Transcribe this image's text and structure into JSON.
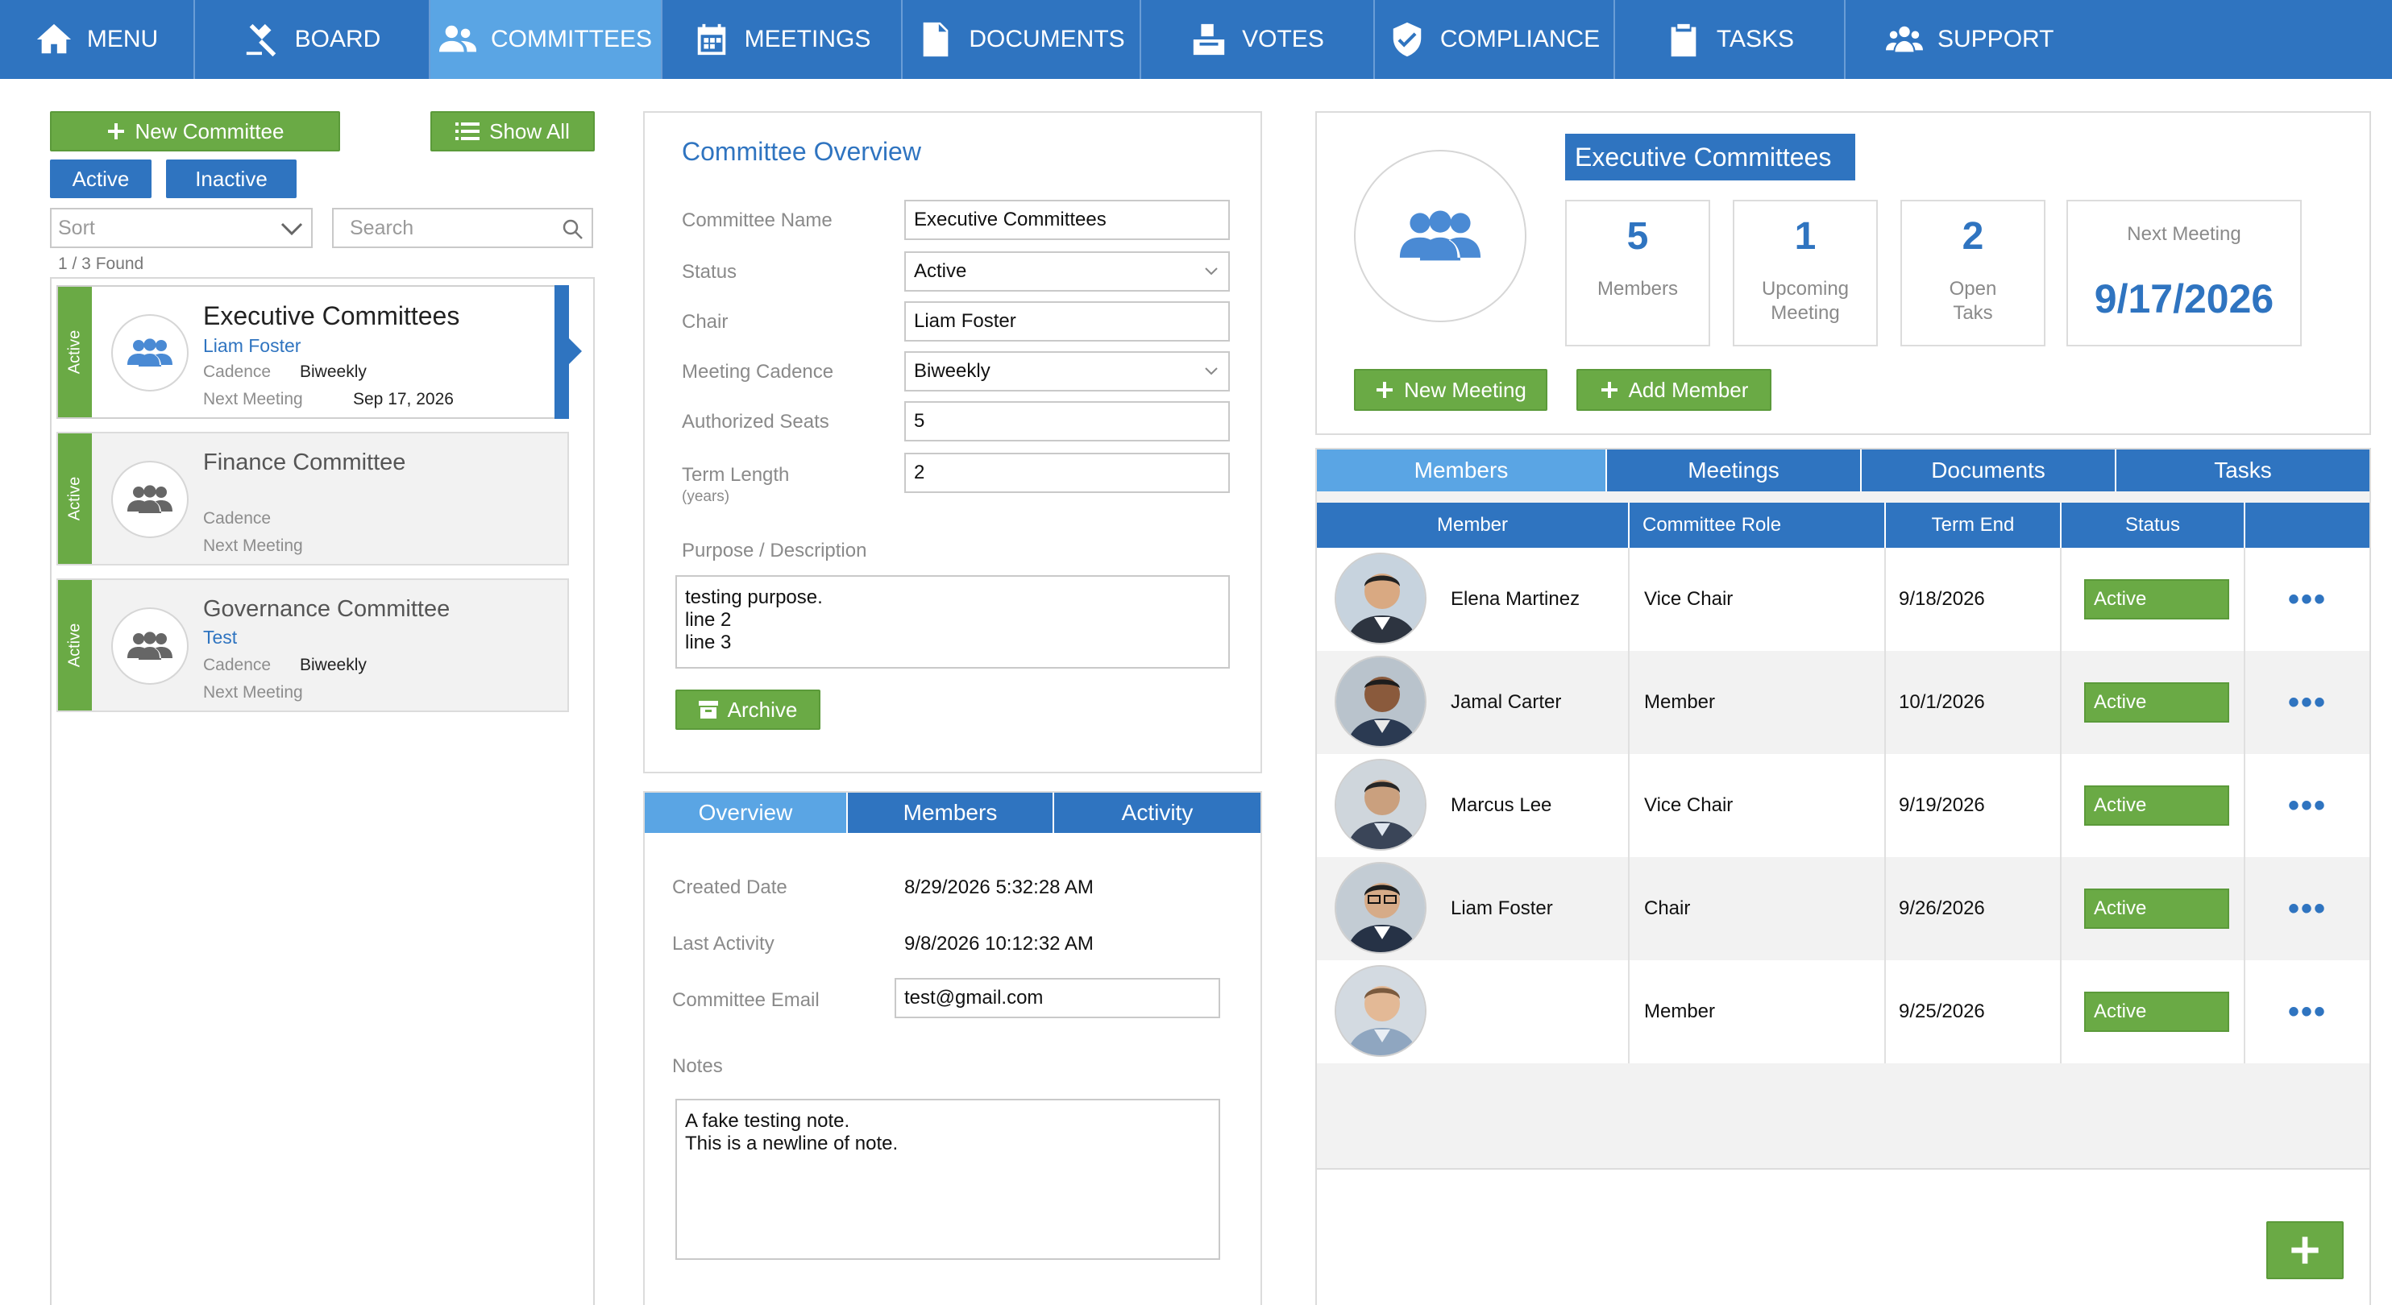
{
  "nav": {
    "items": [
      {
        "label": "MENU",
        "icon": "home-icon"
      },
      {
        "label": "BOARD",
        "icon": "gavel-icon"
      },
      {
        "label": "COMMITTEES",
        "icon": "people-icon"
      },
      {
        "label": "MEETINGS",
        "icon": "calendar-icon"
      },
      {
        "label": "DOCUMENTS",
        "icon": "document-icon"
      },
      {
        "label": "VOTES",
        "icon": "ballot-box-icon"
      },
      {
        "label": "COMPLIANCE",
        "icon": "shield-check-icon"
      },
      {
        "label": "TASKS",
        "icon": "clipboard-check-icon"
      },
      {
        "label": "SUPPORT",
        "icon": "support-group-icon"
      }
    ],
    "active": "COMMITTEES"
  },
  "left": {
    "new_committee": "New Committee",
    "show_all": "Show All",
    "filter_active": "Active",
    "filter_inactive": "Inactive",
    "sort_placeholder": "Sort",
    "search_placeholder": "Search",
    "found": "1 / 3 Found",
    "cadence_label": "Cadence",
    "next_meeting_label": "Next Meeting",
    "committees": [
      {
        "status": "Active",
        "name": "Executive Committees",
        "chair": "Liam Foster",
        "cadence": "Biweekly",
        "next_meeting": "Sep 17, 2026"
      },
      {
        "status": "Active",
        "name": "Finance Committee",
        "chair": "",
        "cadence": "",
        "next_meeting": ""
      },
      {
        "status": "Active",
        "name": "Governance Committee",
        "chair": "Test",
        "cadence": "Biweekly",
        "next_meeting": ""
      }
    ]
  },
  "overview": {
    "title": "Committee Overview",
    "fields": {
      "name_label": "Committee Name",
      "name_value": "Executive Committees",
      "status_label": "Status",
      "status_value": "Active",
      "chair_label": "Chair",
      "chair_value": "Liam Foster",
      "cadence_label": "Meeting Cadence",
      "cadence_value": "Biweekly",
      "seats_label": "Authorized Seats",
      "seats_value": "5",
      "term_label": "Term Length",
      "term_sub": "(years)",
      "term_value": "2",
      "purpose_label": "Purpose / Description",
      "purpose_lines": [
        "testing purpose.",
        "line 2",
        "line 3"
      ]
    },
    "archive": "Archive"
  },
  "details": {
    "tabs": [
      "Overview",
      "Members",
      "Activity"
    ],
    "active_tab": "Overview",
    "created_label": "Created Date",
    "created_value": "8/29/2026 5:32:28 AM",
    "activity_label": "Last Activity",
    "activity_value": "9/8/2026 10:12:32 AM",
    "email_label": "Committee Email",
    "email_value": "test@gmail.com",
    "notes_label": "Notes",
    "notes_lines": [
      "A fake testing note.",
      "This is a newline of note."
    ]
  },
  "summary": {
    "title": "Executive Committees",
    "stats": [
      {
        "value": "5",
        "label1": "Members",
        "label2": ""
      },
      {
        "value": "1",
        "label1": "Upcoming",
        "label2": "Meeting"
      },
      {
        "value": "2",
        "label1": "Open",
        "label2": "Taks"
      }
    ],
    "next_meeting_label": "Next Meeting",
    "next_meeting_value": "9/17/2026",
    "new_meeting": "New Meeting",
    "add_member": "Add Member"
  },
  "members": {
    "tabs": [
      "Members",
      "Meetings",
      "Documents",
      "Tasks"
    ],
    "active_tab": "Members",
    "headers": [
      "Member",
      "Committee Role",
      "Term End",
      "Status",
      ""
    ],
    "rows": [
      {
        "name": "Elena Martinez",
        "role": "Vice Chair",
        "term_end": "9/18/2026",
        "status": "Active"
      },
      {
        "name": "Jamal Carter",
        "role": "Member",
        "term_end": "10/1/2026",
        "status": "Active"
      },
      {
        "name": "Marcus Lee",
        "role": "Vice Chair",
        "term_end": "9/19/2026",
        "status": "Active"
      },
      {
        "name": "Liam Foster",
        "role": "Chair",
        "term_end": "9/26/2026",
        "status": "Active"
      },
      {
        "name": "",
        "role": "Member",
        "term_end": "9/25/2026",
        "status": "Active"
      }
    ],
    "more": "•••"
  },
  "colors": {
    "primary": "#2f74c0",
    "active_tab": "#5aa5e4",
    "green": "#6aaa45"
  }
}
